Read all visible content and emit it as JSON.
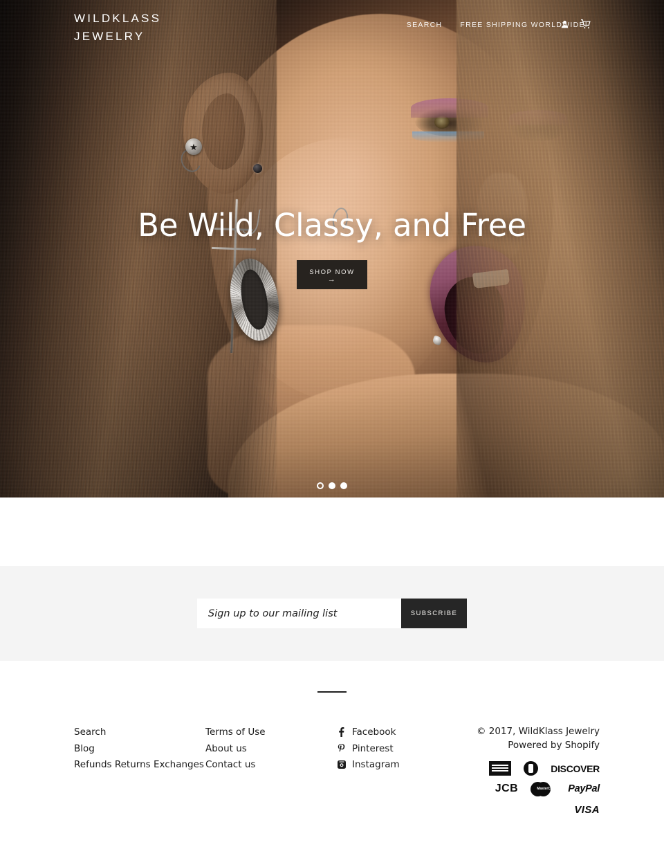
{
  "header": {
    "logo_line1": "WILDKLASS",
    "logo_line2": "JEWELRY",
    "nav": [
      {
        "label": "SEARCH",
        "name": "nav-search"
      },
      {
        "label": "FREE SHIPPING WORLDWIDE!",
        "name": "nav-free-shipping"
      }
    ],
    "account_icon": "user-icon",
    "cart_icon": "shopping-cart-icon"
  },
  "hero": {
    "title": "Be Wild, Classy, and Free",
    "cta_label": "SHOP NOW",
    "cta_arrow": "→",
    "slide_count": 3,
    "active_slide": 1,
    "image_alt": "Close-up of woman wearing cross and hoop earrings"
  },
  "newsletter": {
    "placeholder": "Sign up to our mailing list",
    "value": "",
    "subscribe_label": "SUBSCRIBE"
  },
  "footer": {
    "links_col1": [
      {
        "label": "Search"
      },
      {
        "label": "Blog"
      },
      {
        "label": "Refunds Returns Exchanges"
      }
    ],
    "links_col2": [
      {
        "label": "Terms of Use"
      },
      {
        "label": "About us"
      },
      {
        "label": "Contact us"
      }
    ],
    "social": [
      {
        "label": "Facebook",
        "icon": "facebook-icon",
        "glyph": "f"
      },
      {
        "label": "Pinterest",
        "icon": "pinterest-icon",
        "glyph": "P"
      },
      {
        "label": "Instagram",
        "icon": "instagram-icon",
        "glyph": ""
      }
    ],
    "copyright": "© 2017, WildKlass Jewelry",
    "powered_by": "Powered by Shopify",
    "payments": [
      {
        "label": "American Express",
        "name": "payment-icon-amex"
      },
      {
        "label": "Diners Club",
        "name": "payment-icon-diners"
      },
      {
        "label": "DISCOVER",
        "name": "payment-icon-discover"
      },
      {
        "label": "JCB",
        "name": "payment-icon-jcb"
      },
      {
        "label": "MasterCard",
        "name": "payment-icon-mastercard"
      },
      {
        "label": "PayPal",
        "name": "payment-icon-paypal"
      },
      {
        "label": "VISA",
        "name": "payment-icon-visa"
      }
    ],
    "mastercard_text": "MasterCard"
  },
  "colors": {
    "accent_dark": "#262626",
    "newsletter_bg": "#f4f4f4",
    "text": "#1b1b1b",
    "hero_overlay_text": "#ffffff"
  }
}
